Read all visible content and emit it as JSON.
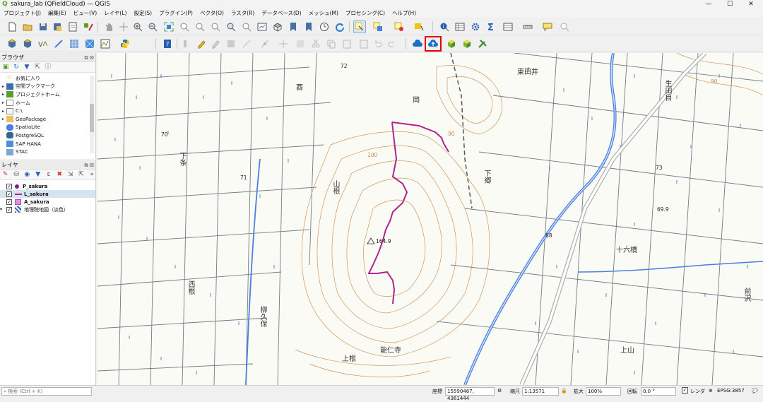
{
  "window": {
    "title": "sakura_lab (QFieldCloud) — QGIS",
    "app_icon": "qgis-icon",
    "minimize": "—",
    "maximize": "☐",
    "close": "✕"
  },
  "menu": [
    "プロジェクト(J)",
    "編集(E)",
    "ビュー(V)",
    "レイヤ(L)",
    "設定(S)",
    "プラグイン(P)",
    "ベクタ(O)",
    "ラスタ(R)",
    "データベース(D)",
    "メッシュ(M)",
    "プロセシング(C)",
    "ヘルプ(H)"
  ],
  "colors": {
    "highlight": "#e60000",
    "line_layer": "#b0248c",
    "point_layer": "#8b1a8b",
    "polygon_layer": "#e58be5",
    "river": "#4a7fe0",
    "contour": "#c98a4a",
    "road": "#888888"
  },
  "browser": {
    "title": "ブラウザ",
    "items": [
      {
        "label": "お気に入り",
        "icon": "star-icon",
        "expandable": false
      },
      {
        "label": "空間ブックマーク",
        "icon": "bookmark-icon",
        "expandable": true
      },
      {
        "label": "プロジェクトホーム",
        "icon": "project-home-icon",
        "expandable": true
      },
      {
        "label": "ホーム",
        "icon": "home-folder-icon",
        "expandable": true
      },
      {
        "label": "C:\\",
        "icon": "drive-icon",
        "expandable": true
      },
      {
        "label": "GeoPackage",
        "icon": "geopackage-icon",
        "expandable": true
      },
      {
        "label": "SpatiaLite",
        "icon": "spatialite-icon",
        "expandable": false
      },
      {
        "label": "PostgreSQL",
        "icon": "postgresql-icon",
        "expandable": false
      },
      {
        "label": "SAP HANA",
        "icon": "saphana-icon",
        "expandable": false
      },
      {
        "label": "STAC",
        "icon": "stac-icon",
        "expandable": false
      }
    ]
  },
  "layers": {
    "title": "レイヤ",
    "items": [
      {
        "label": "P_sakura",
        "type": "point",
        "checked": true,
        "bold": true
      },
      {
        "label": "L_sakura",
        "type": "line",
        "checked": true,
        "bold": true,
        "selected": true
      },
      {
        "label": "A_sakura",
        "type": "polygon",
        "checked": true,
        "bold": true
      },
      {
        "label": "地理院地図（淡色）",
        "type": "raster",
        "checked": true,
        "bold": false
      }
    ]
  },
  "map": {
    "place_labels": [
      "東田井",
      "生田目",
      "酉",
      "岡",
      "山根",
      "下条",
      "下郷",
      "十六橋",
      "西根",
      "柳久保",
      "能仁寺",
      "上根",
      "上山",
      "前沢"
    ],
    "elevations": [
      "72",
      "70",
      "71",
      "73",
      "69.9",
      "68",
      "164.9",
      "90",
      "100",
      "90"
    ]
  },
  "status": {
    "search_placeholder": "検索 (Ctrl + K)",
    "coord_label": "座標",
    "coord_value": "15590467, 4361444",
    "scale_label": "縮尺",
    "scale_value": "1:13571",
    "magnifier_label": "拡大",
    "magnifier_value": "100%",
    "rotation_label": "回転",
    "rotation_value": "0.0 °",
    "render_label": "レンダ",
    "crs": "EPSG:3857"
  }
}
